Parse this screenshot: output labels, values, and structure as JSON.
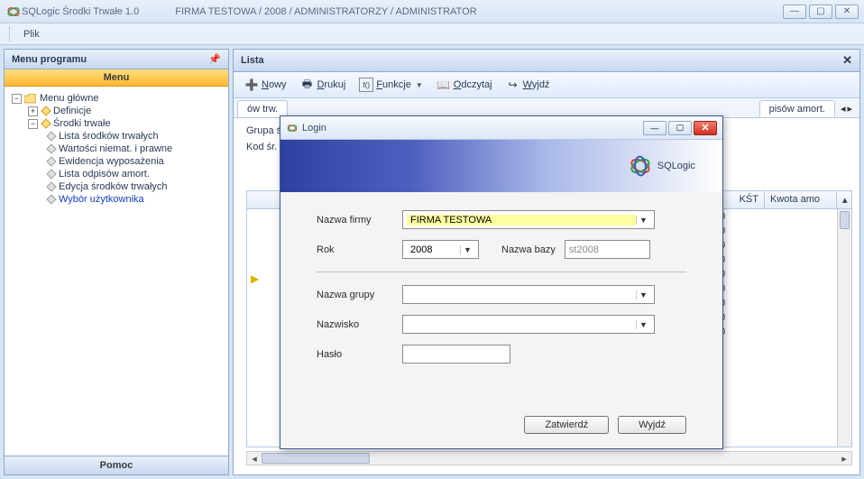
{
  "titlebar": {
    "app_title": "SQLogic Środki Trwałe 1.0",
    "context": "FIRMA TESTOWA / 2008 / ADMINISTRATORZY /  ADMINISTRATOR"
  },
  "menubar": {
    "file": "Plik"
  },
  "sidebar": {
    "header": "Menu programu",
    "menu_band": "Menu",
    "pomoc_band": "Pomoc",
    "tree": {
      "root": "Menu główne",
      "definicje": "Definicje",
      "srodki": "Środki trwałe",
      "items": [
        "Lista środków trwałych",
        "Wartości niemat. i prawne",
        "Ewidencja wyposażenia",
        "Lista odpisów amort.",
        "Edycja środków trwałych",
        "Wybór użytkownika"
      ]
    }
  },
  "content": {
    "header": "Lista",
    "toolbar": {
      "nowy": "Nowy",
      "drukuj": "Drukuj",
      "funkcje": "Funkcje",
      "odczytaj": "Odczytaj",
      "wyjdz": "Wyjdź"
    },
    "tabs": {
      "left": "ów trw.",
      "right": "pisów amort."
    },
    "filters": {
      "grupa_label": "Grupa śr",
      "kod_label": "Kod śr. t"
    },
    "grid": {
      "cols": [
        "KŚT",
        "Kwota amo"
      ],
      "zeros": [
        "0",
        "0",
        "0",
        "0",
        "0",
        "0",
        "0",
        "0",
        "0"
      ]
    }
  },
  "dialog": {
    "title": "Login",
    "brand": "SQLogic",
    "fields": {
      "firma_label": "Nazwa firmy",
      "firma_value": "FIRMA TESTOWA",
      "rok_label": "Rok",
      "rok_value": "2008",
      "baza_label": "Nazwa bazy",
      "baza_value": "st2008",
      "grupa_label": "Nazwa grupy",
      "grupa_value": "",
      "nazwisko_label": "Nazwisko",
      "nazwisko_value": "",
      "haslo_label": "Hasło"
    },
    "buttons": {
      "ok": "Zatwierdź",
      "cancel": "Wyjdź"
    }
  }
}
